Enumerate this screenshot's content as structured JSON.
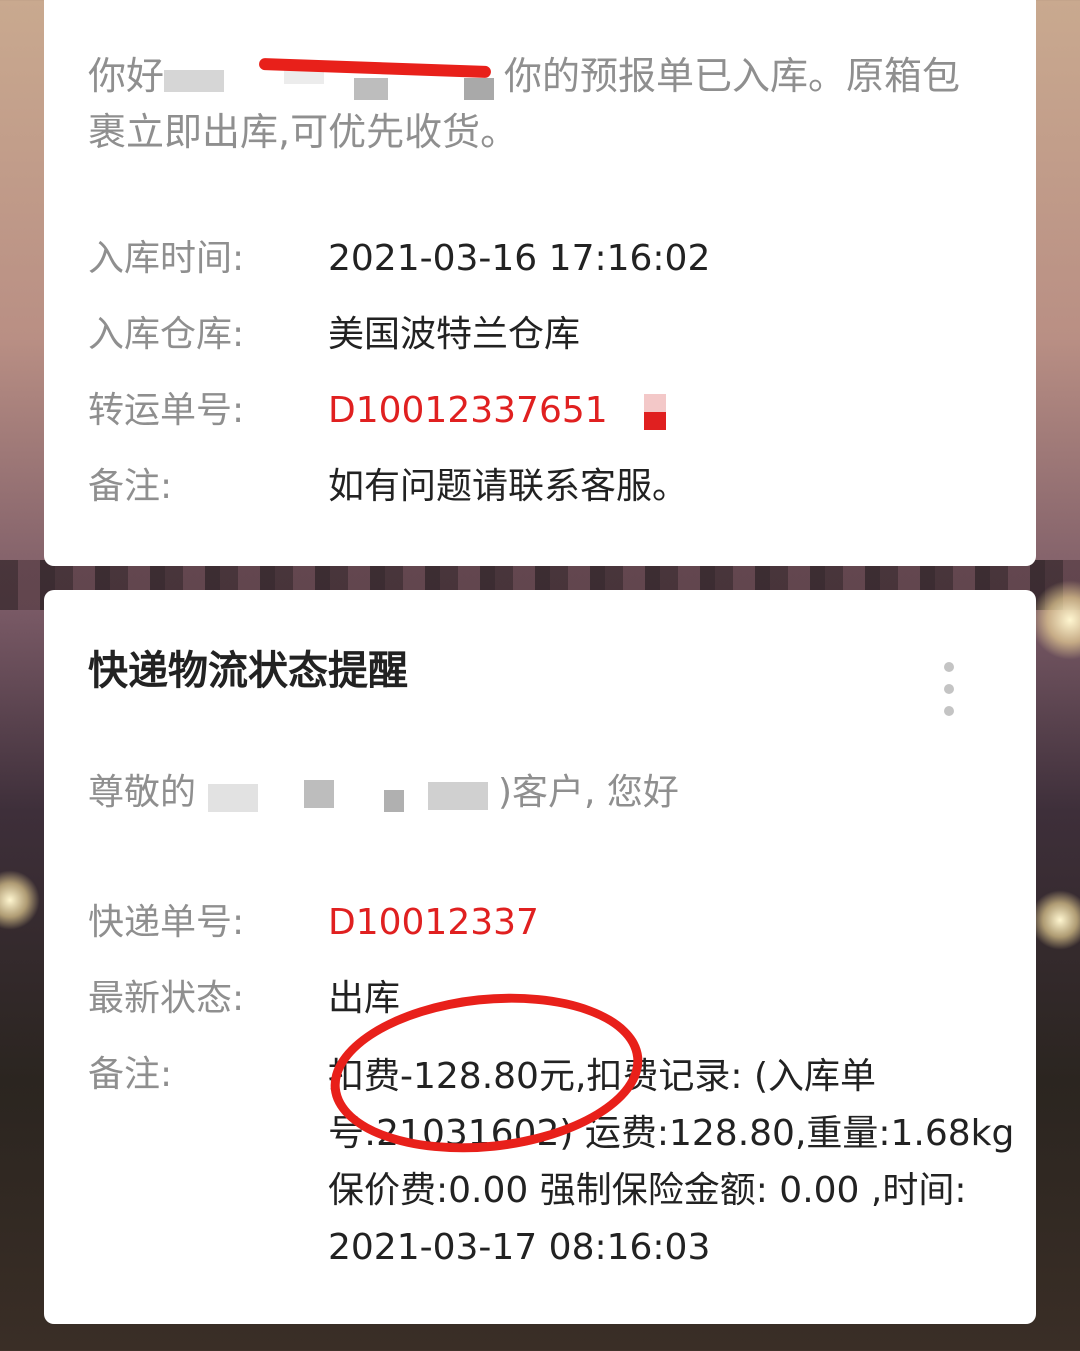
{
  "card1": {
    "greeting_prefix": "你好",
    "greeting_suffix": "你的预报单已入库。原箱包裹立即出库,可优先收货。",
    "rows": [
      {
        "label": "入库时间:",
        "value": "2021-03-16 17:16:02"
      },
      {
        "label": "入库仓库:",
        "value": "美国波特兰仓库"
      },
      {
        "label": "转运单号:",
        "value": "D10012337651"
      },
      {
        "label": "备注:",
        "value": "如有问题请联系客服。"
      }
    ]
  },
  "card2": {
    "title": "快递物流状态提醒",
    "greeting_prefix": "尊敬的",
    "greeting_suffix": ")客户, 您好",
    "rows": [
      {
        "label": "快递单号:",
        "value": "D10012337"
      },
      {
        "label": "最新状态:",
        "value": "出库"
      },
      {
        "label": "备注:",
        "value": "扣费-128.80元,扣费记录: (入库单号:21031602) 运费:128.80,重量:1.68kg 保价费:0.00 强制保险金额: 0.00 ,时间: 2021-03-17 08:16:03"
      }
    ]
  },
  "icons": {
    "more": "more-vertical-icon"
  },
  "colors": {
    "accent_red": "#e02020",
    "label_gray": "#8f8f8f",
    "text_dark": "#222222"
  }
}
